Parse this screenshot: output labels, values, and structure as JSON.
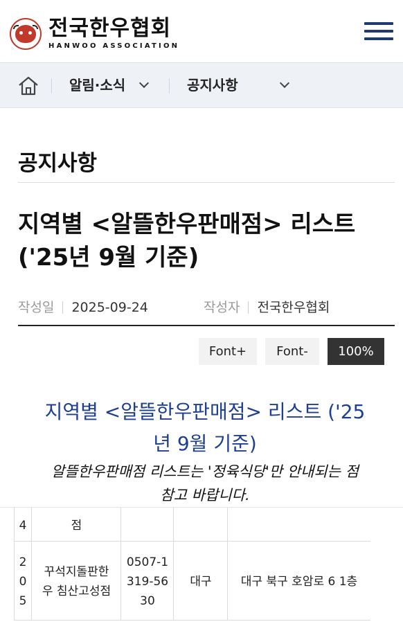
{
  "header": {
    "logo_korean": "전국한우협회",
    "logo_english": "HANWOO ASSOCIATION",
    "logo_seal_text": "전국한우협회 HANWOO ASSOCIATION",
    "menu_icon": "hamburger-icon"
  },
  "breadcrumb": {
    "home_icon": "home-icon",
    "level1": "알림·소식",
    "level2": "공지사항"
  },
  "page_title": "공지사항",
  "article": {
    "title_line1": "지역별 <알뜰한우판매점> 리스트",
    "title_line2": "('25년 9월 기준)",
    "date_label": "작성일",
    "date_value": "2025-09-24",
    "author_label": "작성자",
    "author_value": "전국한우협회"
  },
  "font_controls": {
    "increase": "Font+",
    "decrease": "Font-",
    "zoom": "100%"
  },
  "content": {
    "heading_line1": "지역별 <알뜰한우판매점> 리스트 ('25",
    "heading_line2": "년 9월 기준)",
    "note_line1": "알뜰한우판매점 리스트는 '정육식당'만 안내되는 점",
    "note_line2": "참고 바랍니다."
  },
  "table": {
    "prev_row": {
      "no_fragment": "4",
      "name_fragment": "점"
    },
    "row": {
      "no": [
        "2",
        "0",
        "5"
      ],
      "name": [
        "꾸석지돌판한",
        "우 침산고성점"
      ],
      "phone": [
        "0507-1",
        "319-56",
        "30"
      ],
      "region": "대구",
      "address": "대구 북구 호암로 6 1층"
    }
  },
  "colors": {
    "brand_navy": "#1e3a6e",
    "content_heading_blue": "#1e3f8f",
    "logo_red": "#c0392b"
  }
}
